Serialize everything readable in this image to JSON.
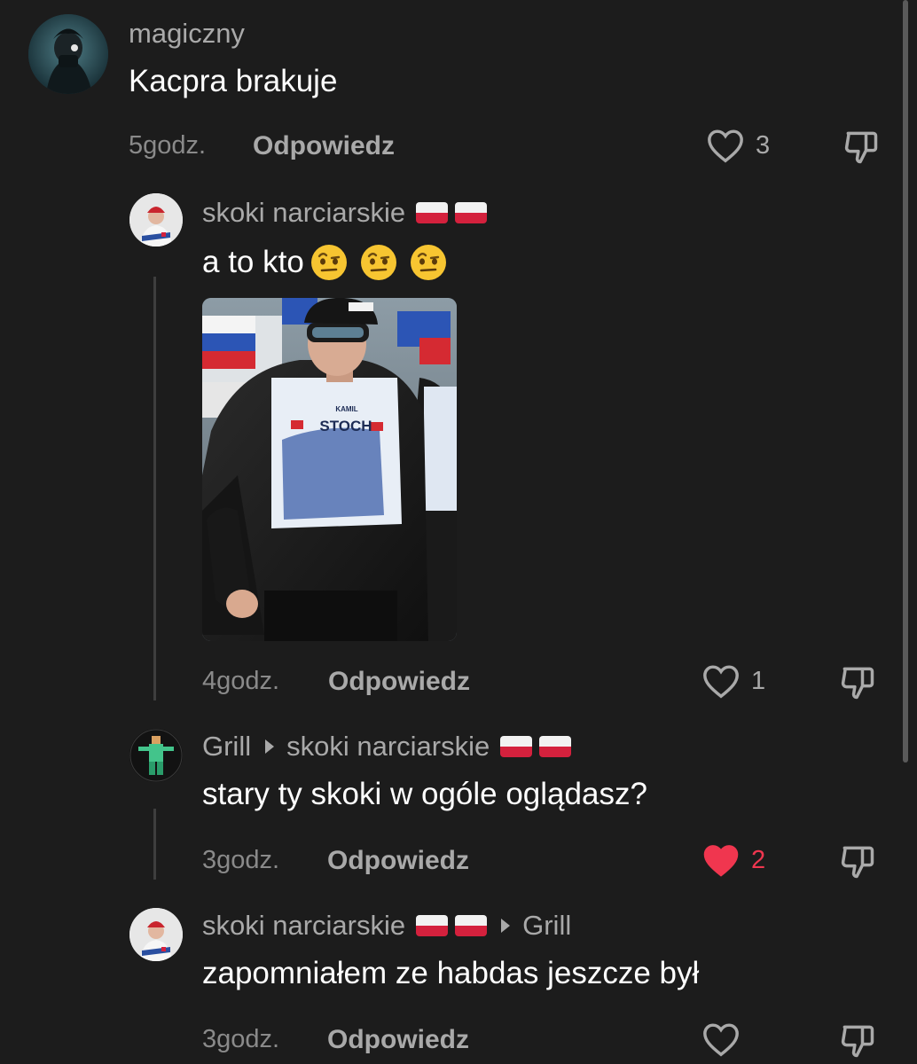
{
  "comments": [
    {
      "username": "magiczny",
      "text": "Kacpra brakuje",
      "time": "5godz.",
      "reply_label": "Odpowiedz",
      "likes": "3",
      "liked": false
    },
    {
      "username": "skoki narciarskie",
      "text": "a to kto",
      "image_alt": "photo",
      "time": "4godz.",
      "reply_label": "Odpowiedz",
      "likes": "1",
      "liked": false
    },
    {
      "username": "Grill",
      "reply_to": "skoki narciarskie",
      "text": "stary ty skoki w ogóle oglądasz?",
      "time": "3godz.",
      "reply_label": "Odpowiedz",
      "likes": "2",
      "liked": true
    },
    {
      "username": "skoki narciarskie",
      "reply_to": "Grill",
      "text": "zapomniałem ze habdas jeszcze był",
      "time": "3godz.",
      "reply_label": "Odpowiedz",
      "likes": "",
      "liked": false
    }
  ],
  "photo_text": {
    "name_small": "KAMIL",
    "name_big": "STOCH"
  },
  "colors": {
    "background": "#1c1c1c",
    "liked_heart": "#f0364f",
    "muted_text": "#a9a9a9"
  }
}
